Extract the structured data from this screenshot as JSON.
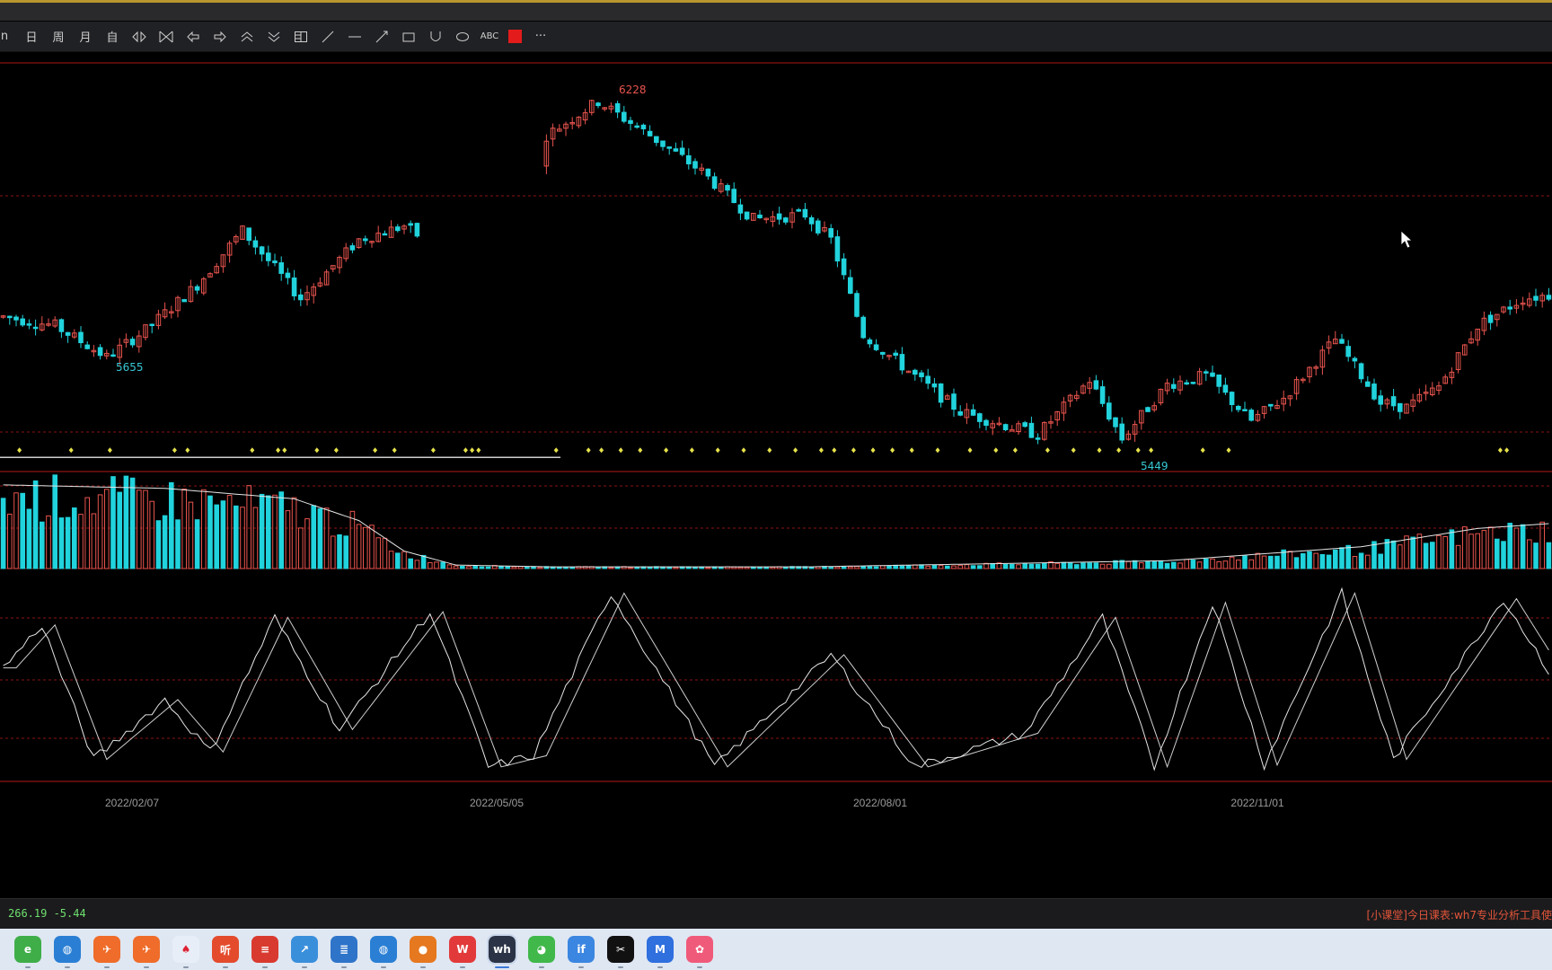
{
  "toolbar": {
    "items": [
      {
        "label": "n",
        "icon": "partial-text-icon"
      },
      {
        "label": "日",
        "icon": "daily-period"
      },
      {
        "label": "周",
        "icon": "weekly-period"
      },
      {
        "label": "月",
        "icon": "monthly-period"
      },
      {
        "label": "自",
        "icon": "custom-period"
      },
      {
        "label": "",
        "icon": "diamond-arrows-icon"
      },
      {
        "label": "",
        "icon": "hourglass-icon"
      },
      {
        "label": "",
        "icon": "arrow-left-icon"
      },
      {
        "label": "",
        "icon": "arrow-right-icon"
      },
      {
        "label": "",
        "icon": "double-up-icon"
      },
      {
        "label": "",
        "icon": "double-down-icon"
      },
      {
        "label": "",
        "icon": "layout-icon"
      },
      {
        "label": "",
        "icon": "line-tool-icon"
      },
      {
        "label": "",
        "icon": "hline-tool-icon"
      },
      {
        "label": "",
        "icon": "ray-tool-icon"
      },
      {
        "label": "",
        "icon": "rectangle-tool-icon"
      },
      {
        "label": "",
        "icon": "cup-tool-icon"
      },
      {
        "label": "",
        "icon": "ellipse-tool-icon"
      },
      {
        "label": "ABC",
        "icon": "text-tool-icon"
      },
      {
        "label": "",
        "icon": "color-picker-icon"
      },
      {
        "label": "···",
        "icon": "more-icon"
      }
    ]
  },
  "colors": {
    "up": "#e8544e",
    "down": "#21d3dc",
    "grid": "#8a1414",
    "marker": "#e6e24a",
    "line": "#e6e6e6",
    "label_high": "#e8544e",
    "label_low": "#37c8d4",
    "axis_text": "#9a9a9a"
  },
  "price_panel": {
    "high_label": "6228",
    "low_label": "5655",
    "low_label_2": "5449"
  },
  "x_axis": {
    "labels": [
      "2022/02/07",
      "2022/05/05",
      "2022/08/01",
      "2022/11/01"
    ]
  },
  "chart_data": {
    "type": "candlestick",
    "price_points": [
      {
        "i": 0,
        "v": 5740
      },
      {
        "i": 8,
        "v": 5720
      },
      {
        "i": 16,
        "v": 5650
      },
      {
        "i": 22,
        "v": 5710
      },
      {
        "i": 30,
        "v": 5810
      },
      {
        "i": 37,
        "v": 5930
      },
      {
        "i": 46,
        "v": 5780
      },
      {
        "i": 55,
        "v": 5910
      },
      {
        "i": 62,
        "v": 5940
      },
      {
        "i": 67,
        "v": 5890
      },
      {
        "i": 72,
        "v": 5795
      },
      {
        "i": 77,
        "v": 5780
      },
      {
        "i": 80,
        "v": 5870
      },
      {
        "i": 84,
        "v": 6140
      },
      {
        "i": 92,
        "v": 6215
      },
      {
        "i": 100,
        "v": 6140
      },
      {
        "i": 108,
        "v": 6060
      },
      {
        "i": 116,
        "v": 5955
      },
      {
        "i": 124,
        "v": 5965
      },
      {
        "i": 128,
        "v": 5910
      },
      {
        "i": 133,
        "v": 5700
      },
      {
        "i": 140,
        "v": 5620
      },
      {
        "i": 148,
        "v": 5530
      },
      {
        "i": 155,
        "v": 5500
      },
      {
        "i": 160,
        "v": 5480
      },
      {
        "i": 168,
        "v": 5600
      },
      {
        "i": 173,
        "v": 5470
      },
      {
        "i": 180,
        "v": 5590
      },
      {
        "i": 186,
        "v": 5610
      },
      {
        "i": 193,
        "v": 5510
      },
      {
        "i": 198,
        "v": 5560
      },
      {
        "i": 206,
        "v": 5690
      },
      {
        "i": 213,
        "v": 5550
      },
      {
        "i": 217,
        "v": 5540
      },
      {
        "i": 222,
        "v": 5585
      },
      {
        "i": 228,
        "v": 5720
      },
      {
        "i": 235,
        "v": 5780
      },
      {
        "i": 240,
        "v": 5790
      }
    ],
    "volume_ma_points": [
      {
        "i": 0,
        "v": 0.96
      },
      {
        "i": 25,
        "v": 0.92
      },
      {
        "i": 45,
        "v": 0.8
      },
      {
        "i": 55,
        "v": 0.55
      },
      {
        "i": 62,
        "v": 0.2
      },
      {
        "i": 70,
        "v": 0.04
      },
      {
        "i": 84,
        "v": 0.02
      },
      {
        "i": 125,
        "v": 0.02
      },
      {
        "i": 180,
        "v": 0.09
      },
      {
        "i": 210,
        "v": 0.25
      },
      {
        "i": 228,
        "v": 0.46
      },
      {
        "i": 240,
        "v": 0.52
      }
    ],
    "oscillator_k": [
      {
        "i": 0,
        "v": 0.55
      },
      {
        "i": 6,
        "v": 0.78
      },
      {
        "i": 14,
        "v": 0.06
      },
      {
        "i": 25,
        "v": 0.38
      },
      {
        "i": 32,
        "v": 0.1
      },
      {
        "i": 42,
        "v": 0.82
      },
      {
        "i": 52,
        "v": 0.22
      },
      {
        "i": 66,
        "v": 0.85
      },
      {
        "i": 75,
        "v": 0.02
      },
      {
        "i": 82,
        "v": 0.08
      },
      {
        "i": 94,
        "v": 0.95
      },
      {
        "i": 110,
        "v": 0.02
      },
      {
        "i": 128,
        "v": 0.62
      },
      {
        "i": 141,
        "v": 0.02
      },
      {
        "i": 158,
        "v": 0.2
      },
      {
        "i": 170,
        "v": 0.82
      },
      {
        "i": 178,
        "v": 0.02
      },
      {
        "i": 187,
        "v": 0.9
      },
      {
        "i": 195,
        "v": 0.03
      },
      {
        "i": 207,
        "v": 0.95
      },
      {
        "i": 215,
        "v": 0.06
      },
      {
        "i": 232,
        "v": 0.92
      },
      {
        "i": 240,
        "v": 0.48
      }
    ],
    "n_bars": 240,
    "y_range": [
      5400,
      6300
    ],
    "markers_y": 0.95
  },
  "status": {
    "left": "266.19 -5.44",
    "right": "[小课堂]今日课表:wh7专业分析工具使"
  },
  "taskbar": {
    "apps": [
      {
        "name": "iqiyi-browser",
        "color": "#3fae49",
        "glyph": "e"
      },
      {
        "name": "edge-browser",
        "color": "#2a7fd4",
        "glyph": "◍"
      },
      {
        "name": "orange-app-1",
        "color": "#ef6c2a",
        "glyph": "✈"
      },
      {
        "name": "orange-app-2",
        "color": "#ef6c2a",
        "glyph": "✈"
      },
      {
        "name": "poker-app",
        "color": "#e8eef7",
        "glyph": "♠"
      },
      {
        "name": "listen-app",
        "color": "#e34b2c",
        "glyph": "听"
      },
      {
        "name": "news-app",
        "color": "#d93a2f",
        "glyph": "≡"
      },
      {
        "name": "stock-app",
        "color": "#3a8fdb",
        "glyph": "↗"
      },
      {
        "name": "notes-app",
        "color": "#2e74c9",
        "glyph": "≣"
      },
      {
        "name": "edge-browser-2",
        "color": "#2a7fd4",
        "glyph": "◍"
      },
      {
        "name": "game-app",
        "color": "#e6781f",
        "glyph": "●"
      },
      {
        "name": "wps-app",
        "color": "#e23a3a",
        "glyph": "W"
      },
      {
        "name": "wh6-app",
        "color": "#2b3446",
        "glyph": "wh"
      },
      {
        "name": "wechat-app",
        "color": "#40b84a",
        "glyph": "◕"
      },
      {
        "name": "ifly-app",
        "color": "#3b86e0",
        "glyph": "if"
      },
      {
        "name": "capcut-app",
        "color": "#111111",
        "glyph": "✂"
      },
      {
        "name": "mail-app",
        "color": "#2f6fde",
        "glyph": "M"
      },
      {
        "name": "camera-app",
        "color": "#f05a7a",
        "glyph": "✿"
      }
    ],
    "active_index": 12
  }
}
